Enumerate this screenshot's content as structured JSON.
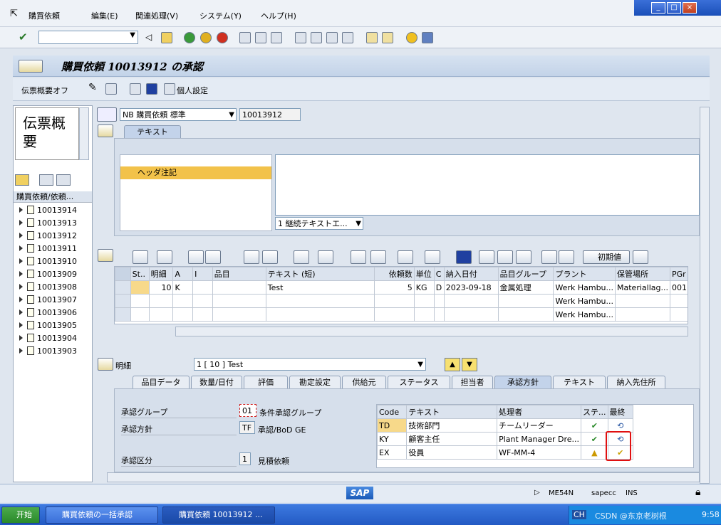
{
  "menu": {
    "items": [
      "購買依頼",
      "編集(E)",
      "関連処理(V)",
      "システム(Y)",
      "ヘルプ(H)"
    ]
  },
  "window": {
    "buttons": [
      "_",
      "□",
      "×"
    ]
  },
  "title": "購買依頼 10013912 の承認",
  "app_toolbar": {
    "summary_btn": "伝票概要オフ",
    "personal_btn": "個人設定"
  },
  "left_panel": {
    "preview_text": "伝票概要",
    "header": "購買依頼/依頼...",
    "items": [
      "10013914",
      "10013913",
      "10013912",
      "10013911",
      "10013910",
      "10013909",
      "10013908",
      "10013907",
      "10013906",
      "10013905",
      "10013904",
      "10013903"
    ]
  },
  "doc_header": {
    "doc_type": "NB 購買依頼 標準",
    "doc_number": "10013912"
  },
  "text_section": {
    "tab": "テキスト",
    "tree_item": "ヘッダ注記",
    "dropdown": "1 継続テキストエ..."
  },
  "item_grid": {
    "defaults_btn": "初期値",
    "columns": [
      "St..",
      "明細",
      "A",
      "I",
      "品目",
      "テキスト (短)",
      "依頼数",
      "単位",
      "C",
      "納入日付",
      "品目グループ",
      "プラント",
      "保管場所",
      "PGr"
    ],
    "rows": [
      {
        "st": "",
        "item": "10",
        "a": "K",
        "i": "",
        "material": "",
        "text": "Test",
        "qty": "5",
        "unit": "KG",
        "c": "D",
        "date": "2023-09-18",
        "group": "金属処理",
        "plant": "Werk Hambu...",
        "sloc": "Materiallag...",
        "pgr": "001"
      },
      {
        "st": "",
        "item": "",
        "a": "",
        "i": "",
        "material": "",
        "text": "",
        "qty": "",
        "unit": "",
        "c": "",
        "date": "",
        "group": "",
        "plant": "Werk Hambu...",
        "sloc": "",
        "pgr": ""
      },
      {
        "st": "",
        "item": "",
        "a": "",
        "i": "",
        "material": "",
        "text": "",
        "qty": "",
        "unit": "",
        "c": "",
        "date": "",
        "group": "",
        "plant": "Werk Hambu...",
        "sloc": "",
        "pgr": ""
      }
    ]
  },
  "detail": {
    "label": "明細",
    "selected": "1 [ 10 ] Test",
    "tabs": [
      "品目データ",
      "数量/日付",
      "評価",
      "勘定設定",
      "供給元",
      "ステータス",
      "担当者",
      "承認方針",
      "テキスト",
      "納入先住所"
    ],
    "active_tab": "承認方針",
    "fields": {
      "group_label": "承認グループ",
      "group_value": "01",
      "group_desc": "条件承認グループ",
      "strategy_label": "承認方針",
      "strategy_value": "TF",
      "strategy_desc": "承認/BoD GE",
      "indicator_label": "承認区分",
      "indicator_value": "1",
      "indicator_desc": "見積依頼"
    },
    "approval_table": {
      "columns": [
        "Code",
        "テキスト",
        "処理者",
        "ステ...",
        "最終"
      ],
      "rows": [
        {
          "code": "TD",
          "text": "技術部門",
          "processor": "チームリーダー",
          "status": "check",
          "final": "release"
        },
        {
          "code": "KY",
          "text": "顧客主任",
          "processor": "Plant Manager Dre...",
          "status": "check",
          "final": "release"
        },
        {
          "code": "EX",
          "text": "役員",
          "processor": "WF-MM-4",
          "status": "warning",
          "final": "released"
        }
      ]
    }
  },
  "status_bar": {
    "transaction": "ME54N",
    "system": "sapecc",
    "mode": "INS"
  },
  "taskbar": {
    "start": "开始",
    "task1": "購買依頼の一括承認",
    "task2": "購買依頼 10013912 ...",
    "lang": "CH",
    "time": "9:58",
    "watermark": "CSDN @东京老树根"
  }
}
